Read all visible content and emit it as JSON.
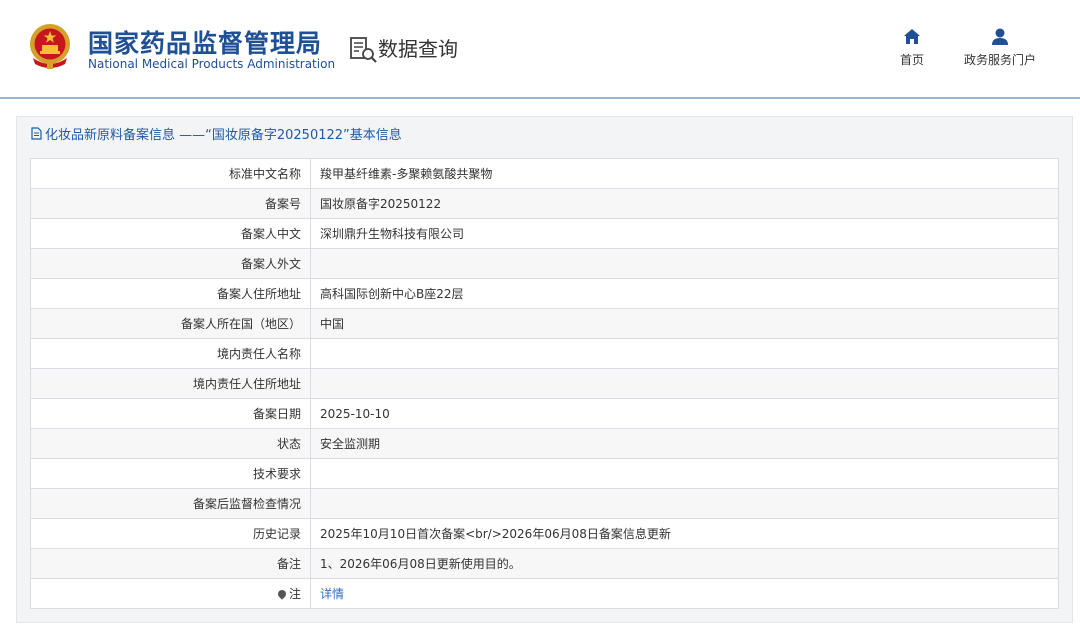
{
  "header": {
    "brand_cn": "国家药品监督管理局",
    "brand_en": "National Medical Products Administration",
    "data_query": "数据查询",
    "nav": [
      {
        "label": "首页",
        "icon": "home-icon"
      },
      {
        "label": "政务服务门户",
        "icon": "user-icon"
      }
    ]
  },
  "panel": {
    "title": "化妆品新原料备案信息 ——“国妆原备字20250122”基本信息",
    "rows": [
      {
        "label": "标准中文名称",
        "value": "羧甲基纤维素-多聚赖氨酸共聚物"
      },
      {
        "label": "备案号",
        "value": "国妆原备字20250122"
      },
      {
        "label": "备案人中文",
        "value": "深圳鼎升生物科技有限公司"
      },
      {
        "label": "备案人外文",
        "value": ""
      },
      {
        "label": "备案人住所地址",
        "value": "高科国际创新中心B座22层"
      },
      {
        "label": "备案人所在国（地区）",
        "value": "中国"
      },
      {
        "label": "境内责任人名称",
        "value": ""
      },
      {
        "label": "境内责任人住所地址",
        "value": ""
      },
      {
        "label": "备案日期",
        "value": "2025-10-10"
      },
      {
        "label": "状态",
        "value": "安全监测期"
      },
      {
        "label": "技术要求",
        "value": ""
      },
      {
        "label": "备案后监督检查情况",
        "value": ""
      },
      {
        "label": "历史记录",
        "value": "2025年10月10日首次备案<br/>2026年06月08日备案信息更新"
      },
      {
        "label": "备注",
        "value": "1、2026年06月08日更新使用目的。"
      },
      {
        "label": "注",
        "value": "详情"
      }
    ]
  },
  "colors": {
    "brand": "#1f4f95",
    "link": "#2f6fc2",
    "header_line": "#9ab4cf"
  }
}
